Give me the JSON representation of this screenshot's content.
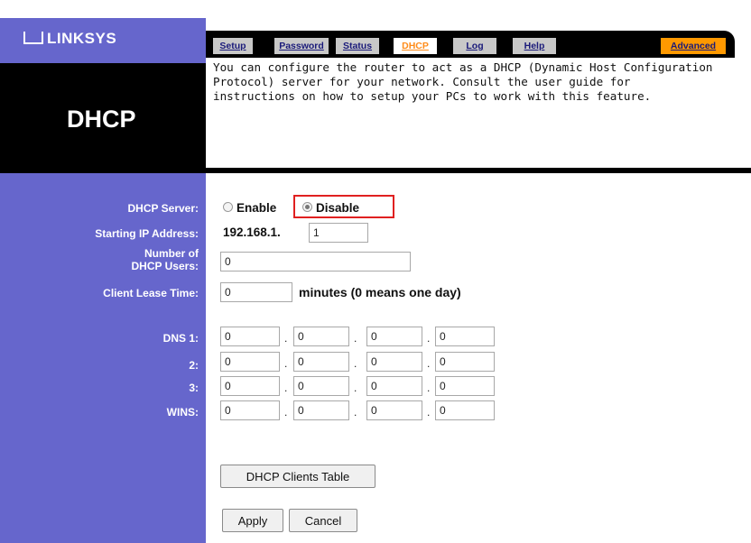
{
  "brand": {
    "logo_text": "LINKSYS"
  },
  "tabs": [
    {
      "label": "Setup",
      "active": false
    },
    {
      "label": "Password",
      "active": false
    },
    {
      "label": "Status",
      "active": false
    },
    {
      "label": "DHCP",
      "active": true
    },
    {
      "label": "Log",
      "active": false
    },
    {
      "label": "Help",
      "active": false
    }
  ],
  "advanced_tab": "Advanced",
  "page": {
    "title": "DHCP",
    "description": "You can configure the router to act as a DHCP (Dynamic Host Configuration Protocol) server for your network. Consult the user guide for instructions on how to setup your PCs to work with this feature."
  },
  "form": {
    "dhcp_server_label": "DHCP Server:",
    "enable_label": "Enable",
    "disable_label": "Disable",
    "dhcp_server_selected": "Disable",
    "starting_ip_label": "Starting IP Address:",
    "ip_prefix": "192.168.1.",
    "starting_ip_last": "1",
    "num_users_label_1": "Number of",
    "num_users_label_2": "DHCP Users:",
    "num_users": "0",
    "lease_label": "Client Lease Time:",
    "lease_value": "0",
    "lease_suffix": "minutes (0 means one day)",
    "dns1_label": "DNS 1:",
    "dns2_label": "2:",
    "dns3_label": "3:",
    "wins_label": "WINS:",
    "dns1": [
      "0",
      "0",
      "0",
      "0"
    ],
    "dns2": [
      "0",
      "0",
      "0",
      "0"
    ],
    "dns3": [
      "0",
      "0",
      "0",
      "0"
    ],
    "wins": [
      "0",
      "0",
      "0",
      "0"
    ],
    "octet_separator": "."
  },
  "buttons": {
    "clients_table": "DHCP Clients Table",
    "apply": "Apply",
    "cancel": "Cancel"
  },
  "colors": {
    "side_panel": "#6666cc",
    "header_black": "#000000",
    "active_tab_text": "#ff8c1a",
    "advanced_tab": "#ff9900",
    "highlight": "#e02020"
  }
}
